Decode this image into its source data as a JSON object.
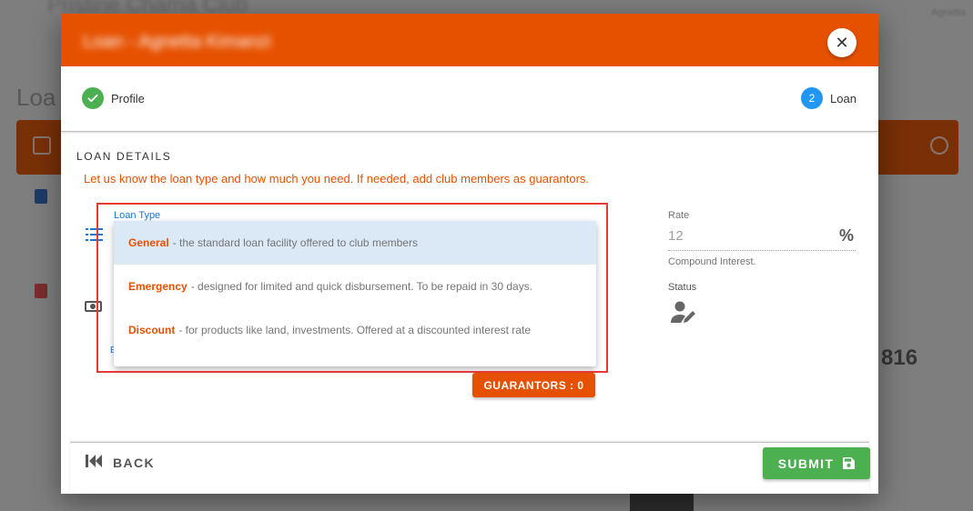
{
  "background": {
    "app_title": "Pristine Chama Club",
    "page_heading": "Loa",
    "user_menu": "Agnetta",
    "stat_value": "816"
  },
  "dialog": {
    "title": "Loan - Agnetta Kimanzi",
    "stepper": {
      "steps": [
        {
          "label": "Profile",
          "state": "complete"
        },
        {
          "number": "2",
          "label": "Loan",
          "state": "active"
        }
      ]
    },
    "section_title": "LOAN DETAILS",
    "section_desc": "Let us know the loan type and how much you need. If needed, add club members as guarantors.",
    "loan_type": {
      "label": "Loan Type",
      "options": [
        {
          "name": "General",
          "desc": "- the standard loan facility offered to club members",
          "selected": true
        },
        {
          "name": "Emergency",
          "desc": "- designed for limited and quick disbursement. To be repaid in 30 days.",
          "selected": false
        },
        {
          "name": "Discount",
          "desc": "- for products like land, investments. Offered at a discounted interest rate",
          "selected": false
        }
      ],
      "stray_char": "E"
    },
    "guarantors_button": "GUARANTORS : 0",
    "rate": {
      "label": "Rate",
      "value": "12",
      "hint": "Compound Interest."
    },
    "status_label": "Status",
    "footer": {
      "back_label": "BACK",
      "submit_label": "SUBMIT"
    }
  },
  "colors": {
    "brand_orange": "#e65100",
    "success_green": "#4caf50",
    "step_blue": "#2196f3",
    "highlight_red": "#e53935"
  }
}
